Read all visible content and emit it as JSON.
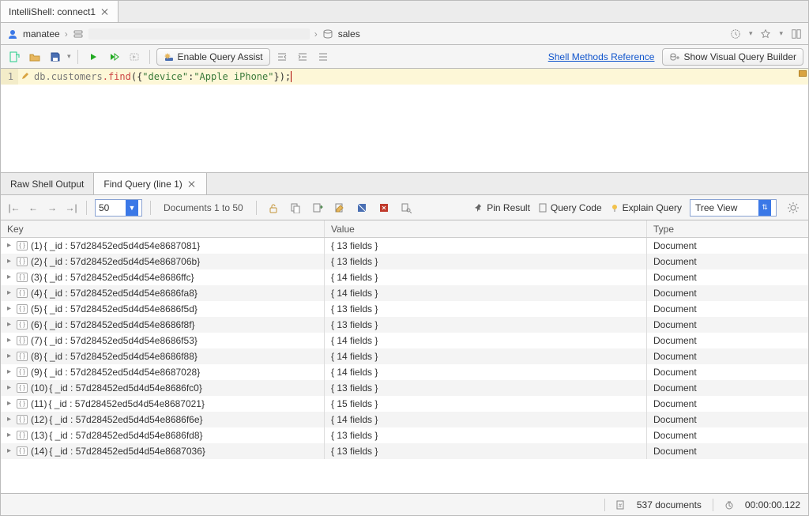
{
  "tab": {
    "title": "IntelliShell: connect1"
  },
  "breadcrumb": {
    "user": "manatee",
    "db": "sales"
  },
  "toolbar": {
    "enable_query_assist": "Enable Query Assist",
    "shell_methods_ref": "Shell Methods Reference",
    "show_visual_qb": "Show Visual Query Builder"
  },
  "editor": {
    "line_no": "1",
    "code_prefix": "db.",
    "code_obj": "customers",
    "code_fn": ".find",
    "code_open": "({",
    "code_key": "\"device\"",
    "code_colon": ":",
    "code_val": "\"Apple iPhone\"",
    "code_close": "});"
  },
  "results_tabs": {
    "raw": "Raw Shell Output",
    "find": "Find Query (line 1)"
  },
  "results_toolbar": {
    "page_size": "50",
    "documents_range": "Documents 1 to 50",
    "pin_result": "Pin Result",
    "query_code": "Query Code",
    "explain_query": "Explain Query",
    "view_mode": "Tree View"
  },
  "columns": {
    "key": "Key",
    "value": "Value",
    "type": "Type"
  },
  "rows": [
    {
      "idx": "(1)",
      "id": "{ _id : 57d28452ed5d4d54e8687081}",
      "value": "{ 13 fields }",
      "type": "Document"
    },
    {
      "idx": "(2)",
      "id": "{ _id : 57d28452ed5d4d54e868706b}",
      "value": "{ 13 fields }",
      "type": "Document"
    },
    {
      "idx": "(3)",
      "id": "{ _id : 57d28452ed5d4d54e8686ffc}",
      "value": "{ 14 fields }",
      "type": "Document"
    },
    {
      "idx": "(4)",
      "id": "{ _id : 57d28452ed5d4d54e8686fa8}",
      "value": "{ 14 fields }",
      "type": "Document"
    },
    {
      "idx": "(5)",
      "id": "{ _id : 57d28452ed5d4d54e8686f5d}",
      "value": "{ 13 fields }",
      "type": "Document"
    },
    {
      "idx": "(6)",
      "id": "{ _id : 57d28452ed5d4d54e8686f8f}",
      "value": "{ 13 fields }",
      "type": "Document"
    },
    {
      "idx": "(7)",
      "id": "{ _id : 57d28452ed5d4d54e8686f53}",
      "value": "{ 14 fields }",
      "type": "Document"
    },
    {
      "idx": "(8)",
      "id": "{ _id : 57d28452ed5d4d54e8686f88}",
      "value": "{ 14 fields }",
      "type": "Document"
    },
    {
      "idx": "(9)",
      "id": "{ _id : 57d28452ed5d4d54e8687028}",
      "value": "{ 14 fields }",
      "type": "Document"
    },
    {
      "idx": "(10)",
      "id": "{ _id : 57d28452ed5d4d54e8686fc0}",
      "value": "{ 13 fields }",
      "type": "Document"
    },
    {
      "idx": "(11)",
      "id": "{ _id : 57d28452ed5d4d54e8687021}",
      "value": "{ 15 fields }",
      "type": "Document"
    },
    {
      "idx": "(12)",
      "id": "{ _id : 57d28452ed5d4d54e8686f6e}",
      "value": "{ 14 fields }",
      "type": "Document"
    },
    {
      "idx": "(13)",
      "id": "{ _id : 57d28452ed5d4d54e8686fd8}",
      "value": "{ 13 fields }",
      "type": "Document"
    },
    {
      "idx": "(14)",
      "id": "{ _id : 57d28452ed5d4d54e8687036}",
      "value": "{ 13 fields }",
      "type": "Document"
    }
  ],
  "status": {
    "count": "537 documents",
    "time": "00:00:00.122"
  }
}
